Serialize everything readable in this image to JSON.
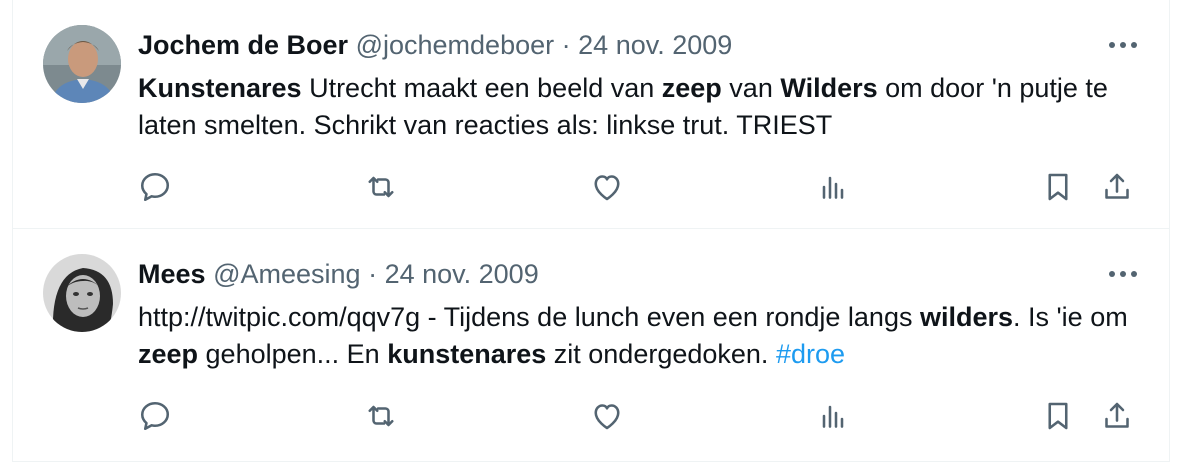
{
  "tweets": [
    {
      "name": "Jochem de Boer",
      "handle": "@jochemdeboer",
      "separator": "·",
      "date": "24 nov. 2009",
      "text_parts": [
        {
          "t": "Kunstenares",
          "bold": true
        },
        {
          "t": " Utrecht maakt een beeld van ",
          "bold": false
        },
        {
          "t": "zeep",
          "bold": true
        },
        {
          "t": " van ",
          "bold": false
        },
        {
          "t": "Wilders",
          "bold": true
        },
        {
          "t": " om door 'n putje te laten smelten. Schrikt van reacties als: linkse trut. TRIEST",
          "bold": false
        }
      ],
      "actions": [
        "reply-icon",
        "retweet-icon",
        "like-icon",
        "views-icon",
        "bookmark-icon",
        "share-icon"
      ]
    },
    {
      "name": "Mees",
      "handle": "@Ameesing",
      "separator": "·",
      "date": "24 nov. 2009",
      "text_parts": [
        {
          "t": "http://twitpic.com/qqv7g - Tijdens de lunch even een rondje langs ",
          "bold": false
        },
        {
          "t": "wilders",
          "bold": true
        },
        {
          "t": ". Is 'ie om ",
          "bold": false
        },
        {
          "t": "zeep",
          "bold": true
        },
        {
          "t": " geholpen... En ",
          "bold": false
        },
        {
          "t": "kunstenares",
          "bold": true
        },
        {
          "t": " zit ondergedoken. ",
          "bold": false
        },
        {
          "t": "#droe",
          "bold": false,
          "hashtag": true
        }
      ],
      "actions": [
        "reply-icon",
        "retweet-icon",
        "like-icon",
        "views-icon",
        "bookmark-icon",
        "share-icon"
      ]
    }
  ],
  "colors": {
    "text": "#0f1419",
    "secondary": "#536471",
    "link": "#1d9bf0",
    "border": "#eff3f4"
  }
}
